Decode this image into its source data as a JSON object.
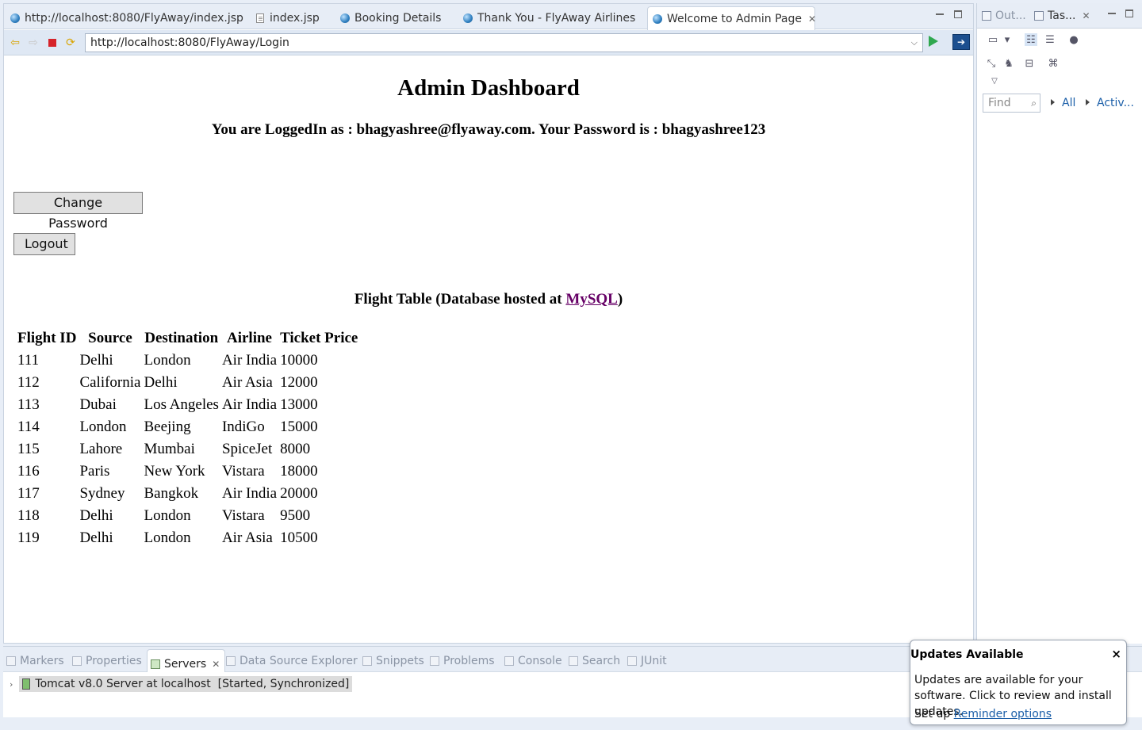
{
  "browser": {
    "tabs": [
      {
        "label": "http://localhost:8080/FlyAway/index.jsp",
        "icon": "globe-icon"
      },
      {
        "label": "index.jsp",
        "icon": "file-icon"
      },
      {
        "label": "Booking Details",
        "icon": "globe-icon"
      },
      {
        "label": "Thank You - FlyAway Airlines",
        "icon": "globe-icon"
      },
      {
        "label": "Welcome to Admin Page",
        "icon": "globe-icon",
        "active": true
      }
    ],
    "url": "http://localhost:8080/FlyAway/Login"
  },
  "page": {
    "title": "Admin Dashboard",
    "logged_in_text": "You are LoggedIn as : bhagyashree@flyaway.com. Your Password is : bhagyashree123",
    "change_password_label": "Change Password",
    "logout_label": "Logout",
    "table_caption_prefix": "Flight Table (Database hosted at ",
    "table_caption_link": "MySQL",
    "table_caption_suffix": ")",
    "link_color": "#660066",
    "table": {
      "headers": [
        "Flight ID",
        "Source",
        "Destination",
        "Airline",
        "Ticket Price"
      ],
      "rows": [
        [
          "111",
          "Delhi",
          "London",
          "Air India",
          "10000"
        ],
        [
          "112",
          "California",
          "Delhi",
          "Air Asia",
          "12000"
        ],
        [
          "113",
          "Dubai",
          "Los Angeles",
          "Air India",
          "13000"
        ],
        [
          "114",
          "London",
          "Beejing",
          "IndiGo",
          "15000"
        ],
        [
          "115",
          "Lahore",
          "Mumbai",
          "SpiceJet",
          "8000"
        ],
        [
          "116",
          "Paris",
          "New York",
          "Vistara",
          "18000"
        ],
        [
          "117",
          "Sydney",
          "Bangkok",
          "Air India",
          "20000"
        ],
        [
          "118",
          "Delhi",
          "London",
          "Vistara",
          "9500"
        ],
        [
          "119",
          "Delhi",
          "London",
          "Air Asia",
          "10500"
        ]
      ]
    }
  },
  "right_panel": {
    "tabs": [
      {
        "label": "Out...",
        "icon": "outline-icon"
      },
      {
        "label": "Tas...",
        "icon": "task-list-icon"
      }
    ],
    "find_placeholder": "Find",
    "filter_all": "All",
    "filter_active": "Activ..."
  },
  "bottom_panel": {
    "tabs": [
      {
        "label": "Markers",
        "icon": "markers-icon"
      },
      {
        "label": "Properties",
        "icon": "properties-icon"
      },
      {
        "label": "Servers",
        "icon": "servers-icon",
        "active": true
      },
      {
        "label": "Data Source Explorer",
        "icon": "data-source-icon"
      },
      {
        "label": "Snippets",
        "icon": "snippets-icon"
      },
      {
        "label": "Problems",
        "icon": "problems-icon"
      },
      {
        "label": "Console",
        "icon": "console-icon"
      },
      {
        "label": "Search",
        "icon": "search-icon"
      },
      {
        "label": "JUnit",
        "icon": "junit-icon"
      }
    ],
    "server_entry": "Tomcat v8.0 Server at localhost  [Started, Synchronized]"
  },
  "notification": {
    "title": "Updates Available",
    "close": "×",
    "body": "Updates are available for your software. Click to review and install updates.",
    "setup_prefix": "Set up ",
    "setup_link": "Reminder options"
  }
}
